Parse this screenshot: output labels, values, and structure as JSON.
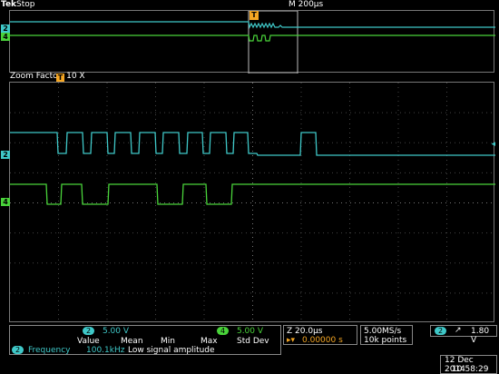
{
  "header": {
    "brand": "Tek",
    "run_state": "Stop",
    "timebase": "M 200µs"
  },
  "overview": {
    "ch2_label": "2",
    "ch4_label": "4",
    "trigger_marker": "T"
  },
  "zoom": {
    "title": "Zoom Factor: 10 X",
    "trigger_marker": "T",
    "ch2_label": "2",
    "ch4_label": "4"
  },
  "channels": {
    "ch2": {
      "badge": "2",
      "scale": "5.00 V",
      "color": "#3fc8c8"
    },
    "ch4": {
      "badge": "4",
      "scale": "5.00 V",
      "color": "#49d33a"
    }
  },
  "measurements": {
    "headers": [
      "Value",
      "Mean",
      "Min",
      "Max",
      "Std Dev"
    ],
    "row": {
      "badge": "2",
      "name": "Frequency",
      "value": "100.1kHz",
      "note": "Low signal amplitude"
    }
  },
  "horizontal": {
    "zoom_scale": "Z 20.0µs",
    "delay_prefix": "▸▾",
    "delay": "0.00000 s"
  },
  "acquisition": {
    "rate": "5.00MS/s",
    "points": "10k points"
  },
  "trigger": {
    "badge": "2",
    "slope_icon": "rising-edge",
    "level": "1.80 V"
  },
  "datetime": {
    "date": "12 Dec  2014",
    "time": "10:58:29"
  }
}
